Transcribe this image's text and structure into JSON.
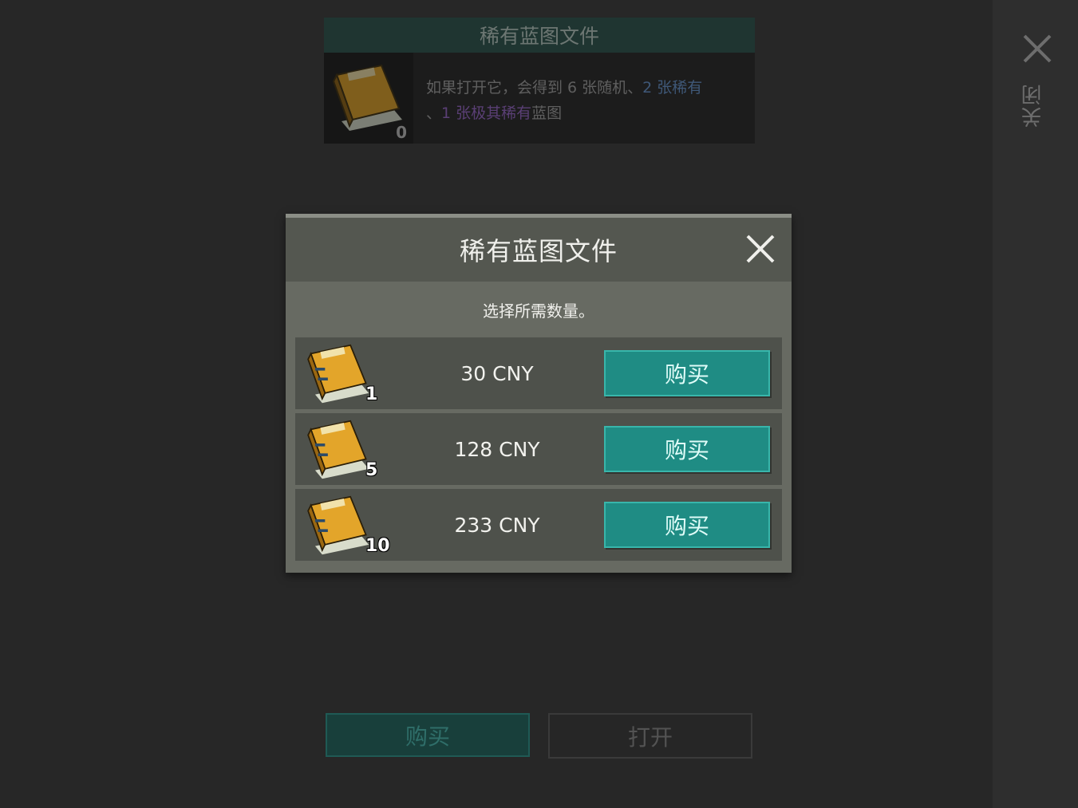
{
  "background": {
    "card": {
      "title": "稀有蓝图文件",
      "count": "0",
      "desc_part1": "如果打开它，会得到 6 张随机、",
      "desc_rare": "2 张稀有",
      "desc_part2": "、",
      "desc_epic": "1 张极其稀有",
      "desc_part3": "蓝图"
    },
    "buy_label": "购买",
    "open_label": "打开"
  },
  "side": {
    "close_label": "关闭"
  },
  "dialog": {
    "title": "稀有蓝图文件",
    "subtitle": "选择所需数量。",
    "options": [
      {
        "qty": "1",
        "price": "30 CNY",
        "buy_label": "购买"
      },
      {
        "qty": "5",
        "price": "128 CNY",
        "buy_label": "购买"
      },
      {
        "qty": "10",
        "price": "233 CNY",
        "buy_label": "购买"
      }
    ]
  },
  "colors": {
    "accent": "#1f8c84",
    "rare": "#3f5878",
    "epic": "#5a3f75"
  },
  "icons": [
    "close-icon",
    "blueprint-folder-icon"
  ]
}
